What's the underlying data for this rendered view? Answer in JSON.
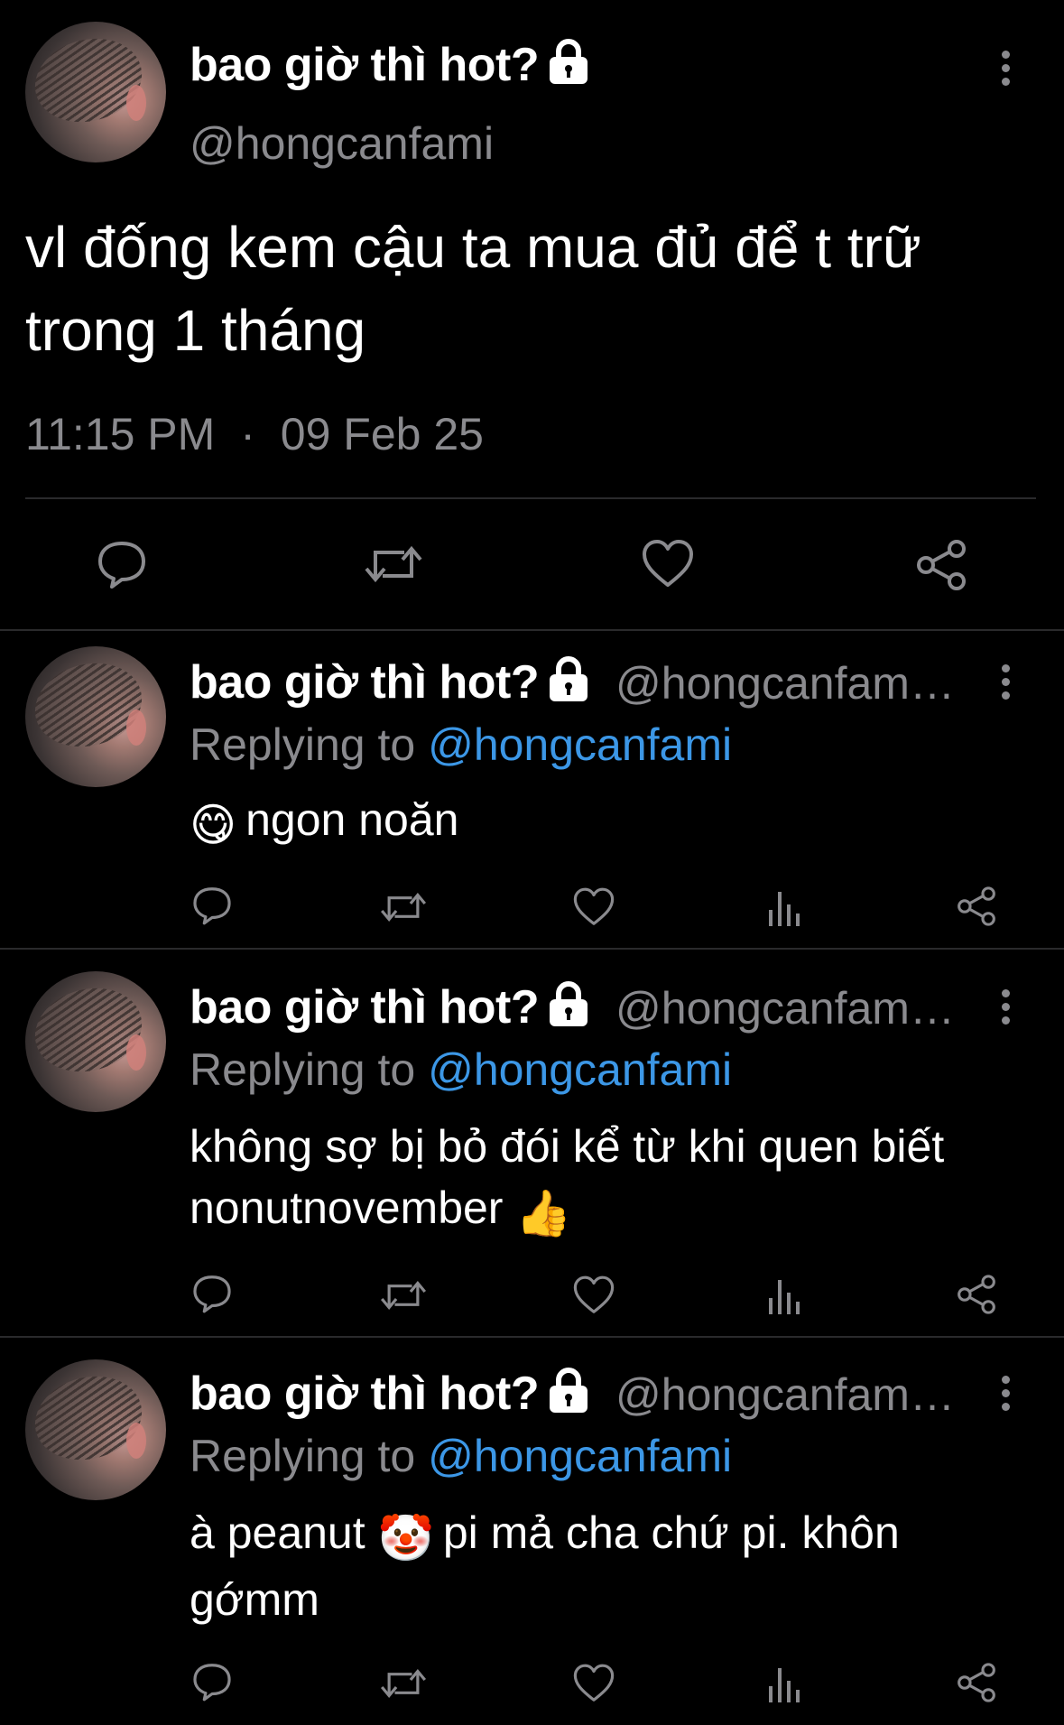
{
  "main_tweet": {
    "display_name": "bao giờ thì hot?",
    "handle": "@hongcanfami",
    "text": "vl đống kem cậu ta mua đủ để t trữ trong 1 tháng",
    "time": "11:15 PM",
    "separator": "·",
    "date": "09 Feb 25"
  },
  "replies": [
    {
      "display_name": "bao giờ thì hot?",
      "handle": "@hongcanfam…",
      "replying_prefix": "Replying to",
      "replying_to": "@hongcanfami",
      "text": "ngon noăn",
      "emoji": "😋"
    },
    {
      "display_name": "bao giờ thì hot?",
      "handle": "@hongcanfam…",
      "replying_prefix": "Replying to",
      "replying_to": "@hongcanfami",
      "text": "không sợ bị bỏ đói kể từ khi quen biết nonutnovember",
      "emoji": "👍"
    },
    {
      "display_name": "bao giờ thì hot?",
      "handle": "@hongcanfam…",
      "replying_prefix": "Replying to",
      "replying_to": "@hongcanfami",
      "text_before": "à peanut",
      "emoji": "🤡",
      "text_after": "pi mả cha chứ pi. khôn gớmm"
    }
  ],
  "icons": [
    "lock-icon",
    "more-icon",
    "reply-icon",
    "retweet-icon",
    "like-icon",
    "views-icon",
    "share-icon"
  ],
  "colors": {
    "background": "#000000",
    "text": "#ffffff",
    "secondary": "#8a8a8e",
    "mention": "#3c97e6",
    "divider": "#2a2a2c"
  }
}
